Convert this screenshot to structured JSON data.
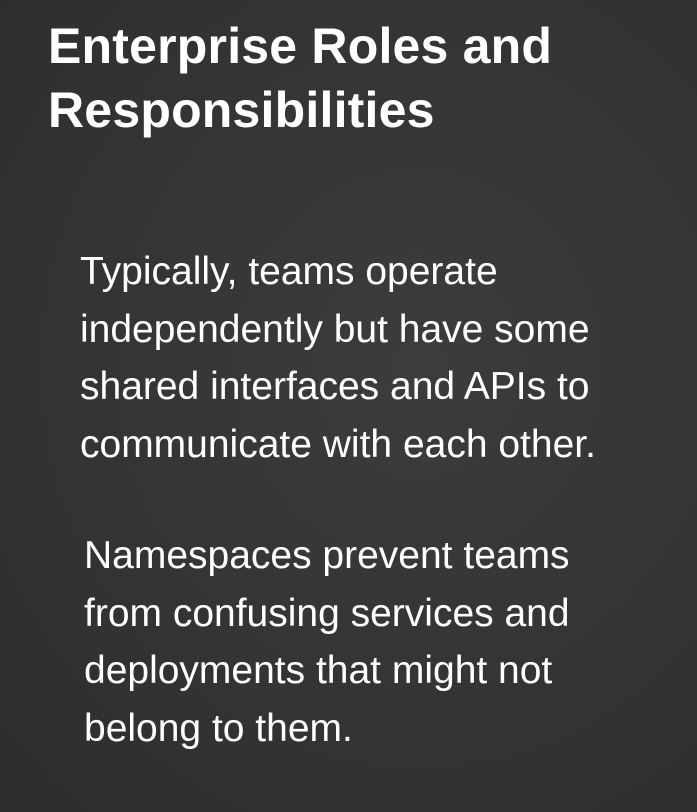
{
  "slide": {
    "title_lines": [
      "Enterprise Roles and",
      "Responsibilities"
    ],
    "paragraphs": [
      {
        "lines": [
          "Typically, teams operate",
          "independently but have some",
          "shared interfaces and APIs to",
          "communicate with each other."
        ]
      },
      {
        "lines": [
          "Namespaces prevent teams",
          "from confusing services and",
          "deployments that might not",
          "belong to them."
        ]
      }
    ]
  },
  "colors": {
    "background": "#333436",
    "text": "#ffffff"
  }
}
